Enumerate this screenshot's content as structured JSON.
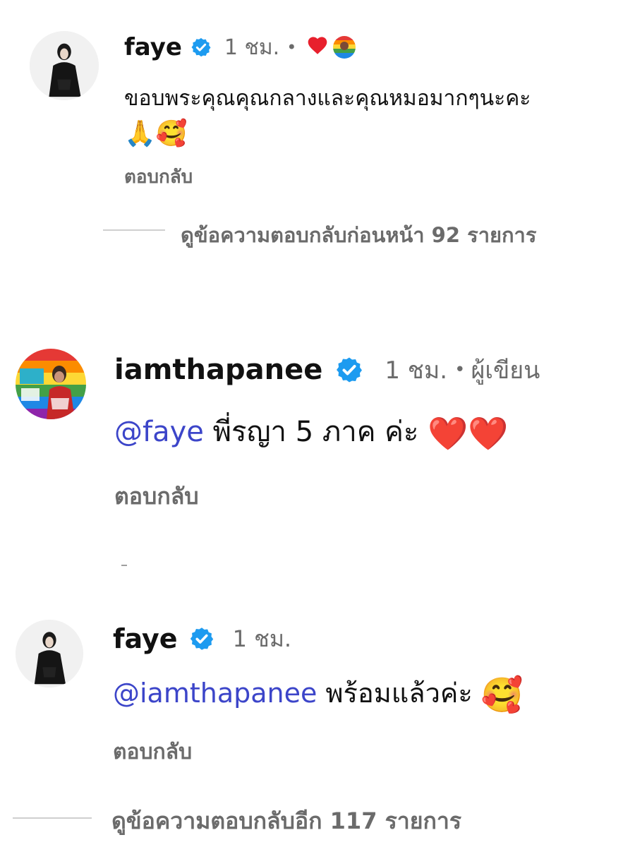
{
  "comments": [
    {
      "username": "faye",
      "time": "1 ชม.",
      "separator": "•",
      "text_line1": "ขอบพระคุณคุณกลางและคุณหมอมากๆนะคะ",
      "emoji_line2": "🙏🥰",
      "reply_label": "ตอบกลับ",
      "avatar_icon": "woman-black-suit-avatar",
      "reaction_icons": [
        "heart-icon",
        "author-avatar-icon"
      ]
    },
    {
      "username": "iamthapanee",
      "time": "1 ชม.",
      "separator": "•",
      "author_label": "ผู้เขียน",
      "mention": "@faye",
      "text": " พี่รญา 5 ภาค ค่ะ ",
      "emoji": "❤️❤️",
      "reply_label": "ตอบกลับ",
      "avatar_icon": "rainbow-profile-avatar"
    },
    {
      "username": "faye",
      "time": "1 ชม.",
      "mention": "@iamthapanee",
      "text": " พร้อมแล้วค่ะ ",
      "emoji": "🥰",
      "reply_label": "ตอบกลับ",
      "avatar_icon": "woman-black-suit-avatar"
    }
  ],
  "view_replies": [
    "ดูข้อความตอบกลับก่อนหน้า 92 รายการ",
    "ดูข้อความตอบกลับอีก 117 รายการ"
  ],
  "colors": {
    "mention": "#3c45c9",
    "verified": "#1d9bf0",
    "muted": "#6b6b6b",
    "heart": "#ff1744"
  }
}
